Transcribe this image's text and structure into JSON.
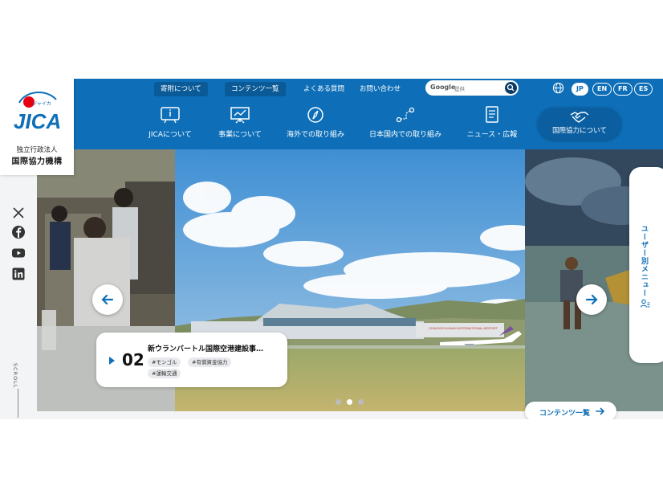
{
  "logo": {
    "brand_text": "JICA",
    "brand_small": "ジャイカ",
    "org_type": "独立行政法人",
    "org_name": "国際協力機構"
  },
  "utility_nav": [
    {
      "label": "寄附について",
      "active": true
    },
    {
      "label": "コンテンツ一覧",
      "active": true
    },
    {
      "label": "よくある質問",
      "active": false
    },
    {
      "label": "お問い合わせ",
      "active": false
    }
  ],
  "search": {
    "provider": "Google",
    "placeholder": "提供"
  },
  "languages": [
    {
      "code": "JP",
      "active": true
    },
    {
      "code": "EN",
      "active": false
    },
    {
      "code": "FR",
      "active": false
    },
    {
      "code": "ES",
      "active": false
    }
  ],
  "main_nav": [
    {
      "label": "JICAについて",
      "icon": "info-board-icon"
    },
    {
      "label": "事業について",
      "icon": "presentation-board-icon"
    },
    {
      "label": "海外での取り組み",
      "icon": "compass-icon"
    },
    {
      "label": "日本国内での取り組み",
      "icon": "route-map-icon"
    },
    {
      "label": "ニュース・広報",
      "icon": "document-icon"
    }
  ],
  "nav_special": {
    "label": "国際協力について",
    "icon": "handshake-icon"
  },
  "social": [
    "x-icon",
    "facebook-icon",
    "youtube-icon",
    "linkedin-icon"
  ],
  "scroll_label": "SCROLL",
  "slider": {
    "number": "02",
    "title": "新ウランバートル国際空港建設事…",
    "tags": [
      "#モンゴル",
      "#有償資金協力",
      "#運輸交通"
    ],
    "airport_sign": "CHINGGIS KHAAN INTERNATIONAL AIRPORT",
    "dot_count": 3,
    "active_dot": 2
  },
  "user_menu": {
    "label": "ユーザー別メニュー"
  },
  "contents_button": {
    "label": "コンテンツ一覧"
  },
  "colors": {
    "brand_blue": "#0e6fb8",
    "dark_blue": "#0b3c68",
    "logo_red": "#e60012"
  }
}
